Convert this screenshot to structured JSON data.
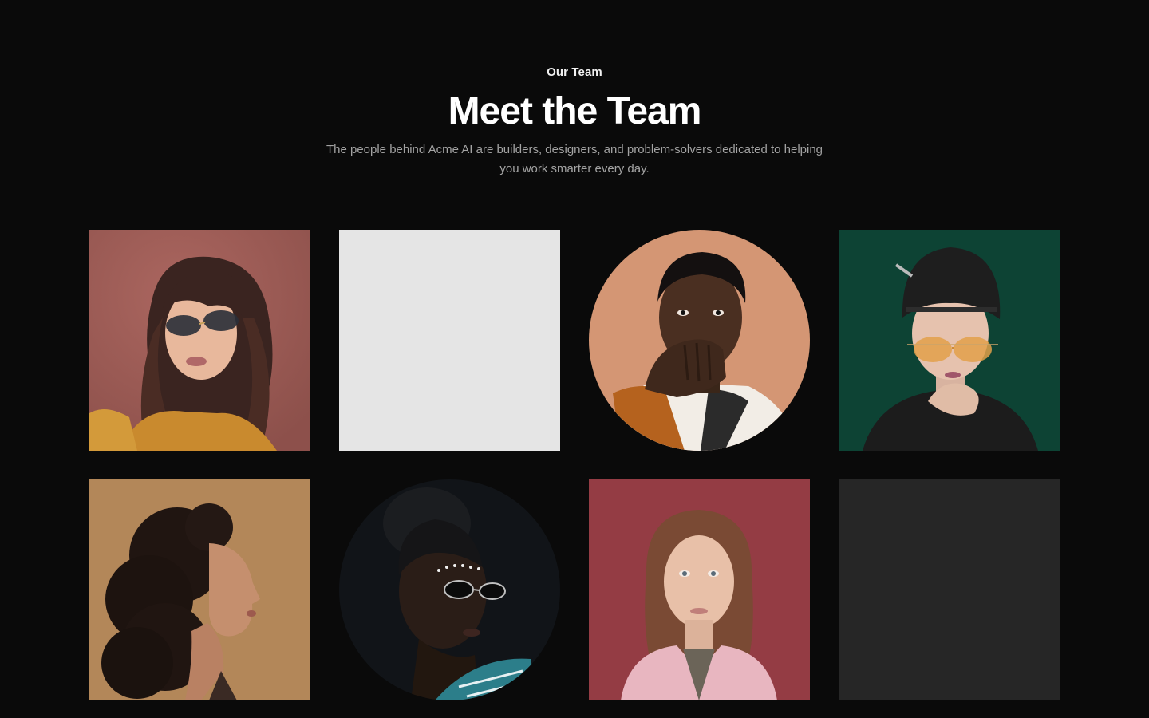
{
  "team": {
    "eyebrow": "Our Team",
    "title": "Meet the Team",
    "subtitle": "The people behind Acme AI are builders, designers, and problem-solvers dedicated to helping you work smarter every day."
  },
  "members": [
    {
      "shape": "square",
      "background": "#a3605a",
      "placeholder": false,
      "photo": "woman-sunglasses-bangs"
    },
    {
      "shape": "square",
      "background": "#e5e5e5",
      "placeholder": true,
      "photo": ""
    },
    {
      "shape": "circle",
      "background": "#d49674",
      "placeholder": false,
      "photo": "man-hand-on-face"
    },
    {
      "shape": "square",
      "background": "#0f4a3a",
      "placeholder": false,
      "photo": "woman-beanie-tinted-glasses"
    },
    {
      "shape": "square",
      "background": "#b98c5c",
      "placeholder": false,
      "photo": "woman-curly-hair-profile"
    },
    {
      "shape": "circle",
      "background": "#111418",
      "placeholder": false,
      "photo": "woman-round-sunglasses"
    },
    {
      "shape": "square",
      "background": "#9a4048",
      "placeholder": false,
      "photo": "woman-pink-blazer"
    },
    {
      "shape": "square",
      "background": "#262626",
      "placeholder": true,
      "photo": ""
    }
  ]
}
